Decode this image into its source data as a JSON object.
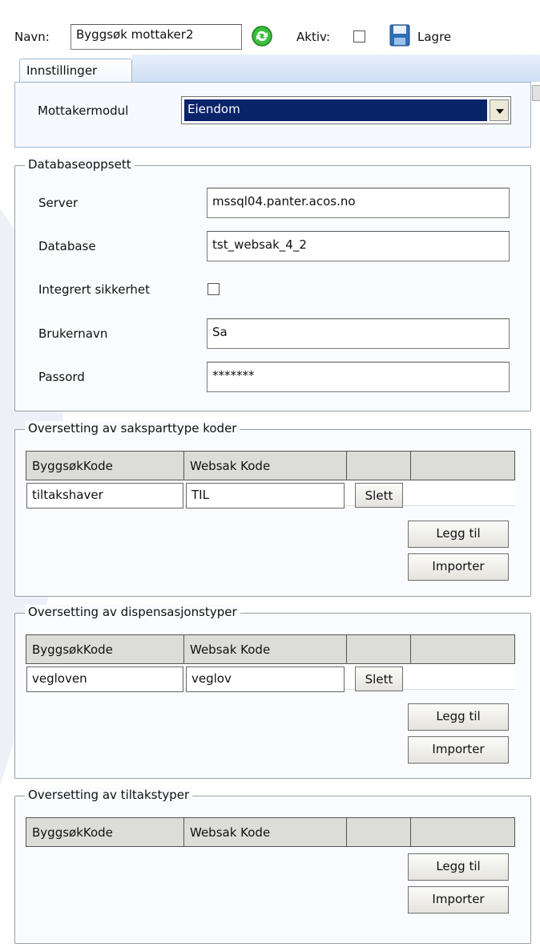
{
  "toolbar": {
    "name_label": "Navn:",
    "name_value": "Byggsøk mottaker2",
    "active_label": "Aktiv:",
    "save_label": "Lagre"
  },
  "tabs": [
    {
      "label": "Innstillinger"
    }
  ],
  "settings": {
    "receiver_module_label": "Mottakermodul",
    "receiver_module_value": "Eiendom"
  },
  "database": {
    "legend": "Databaseoppsett",
    "server_label": "Server",
    "server_value": "mssql04.panter.acos.no",
    "database_label": "Database",
    "database_value": "tst_websak_4_2",
    "integrated_label": "Integrert sikkerhet",
    "username_label": "Brukernavn",
    "username_value": "Sa",
    "password_label": "Passord",
    "password_value": "*******"
  },
  "sections": [
    {
      "legend": "Oversetting av saksparttype koder",
      "col1": "ByggsøkKode",
      "col2": "Websak Kode",
      "rows": [
        {
          "code": "tiltakshaver",
          "websak": "TIL",
          "delete": "Slett"
        }
      ],
      "add": "Legg til",
      "import": "Importer"
    },
    {
      "legend": "Oversetting av dispensasjonstyper",
      "col1": "ByggsøkKode",
      "col2": "Websak Kode",
      "rows": [
        {
          "code": "vegloven",
          "websak": "veglov",
          "delete": "Slett"
        }
      ],
      "add": "Legg til",
      "import": "Importer"
    },
    {
      "legend": "Oversetting av tiltakstyper",
      "col1": "ByggsøkKode",
      "col2": "Websak Kode",
      "rows": [],
      "add": "Legg til",
      "import": "Importer"
    }
  ],
  "colors": {
    "selection": "#0a246a",
    "refresh_icon": "#2aa52a",
    "save_icon": "#2f6fb8"
  }
}
